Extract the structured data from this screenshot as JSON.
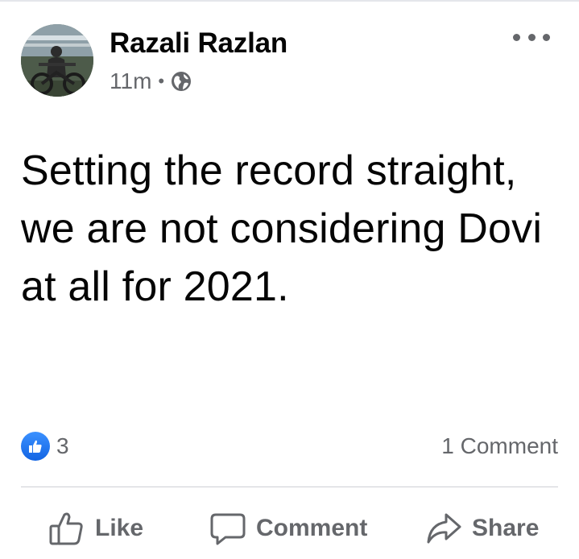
{
  "post": {
    "author": "Razali Razlan",
    "time": "11m",
    "separator": "•",
    "privacy_icon": "globe-icon",
    "menu_icon": "more-options-icon",
    "text": "Setting the record straight, we are not considering Dovi at all for 2021."
  },
  "stats": {
    "like_icon": "like-reaction-icon",
    "reaction_count": "3",
    "comments": "1 Comment"
  },
  "actions": {
    "like": "Like",
    "comment": "Comment",
    "share": "Share"
  },
  "colors": {
    "text_primary": "#050505",
    "text_secondary": "#65676b",
    "like_blue": "#1877f2",
    "divider": "#ced0d4"
  }
}
